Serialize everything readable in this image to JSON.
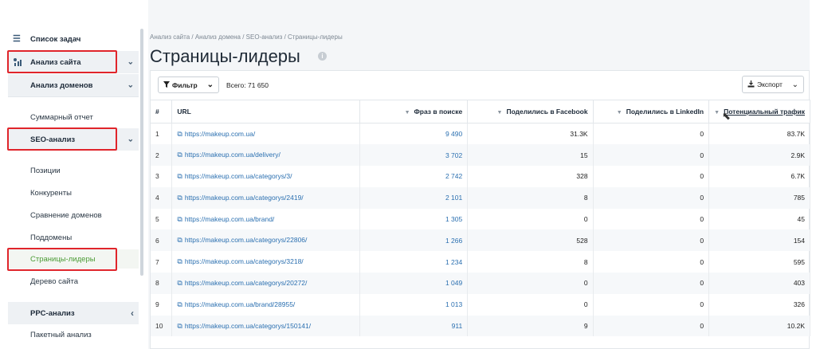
{
  "sidebar": {
    "tasks": "Список задач",
    "site_analysis": "Анализ сайта",
    "domain_analysis": "Анализ доменов",
    "summary": "Суммарный отчет",
    "seo": "SEO-анализ",
    "positions": "Позиции",
    "competitors": "Конкуренты",
    "compare": "Сравнение доменов",
    "subdomains": "Поддомены",
    "leaders": "Страницы-лидеры",
    "tree": "Дерево сайта",
    "ppc": "PPC-анализ",
    "batch": "Пакетный анализ"
  },
  "main": {
    "breadcrumbs": "Анализ сайта / Анализ домена / SEO-анализ / Страницы-лидеры",
    "title": "Страницы-лидеры",
    "filter": "Фильтр",
    "total": "Всего: 71 650",
    "export": "Экспорт"
  },
  "table": {
    "headers": [
      "#",
      "URL",
      "Фраз в поиске",
      "Поделились в Facebook",
      "Поделились в LinkedIn",
      "Потенциальный трафик"
    ],
    "rows": [
      [
        "1",
        "https://makeup.com.ua/",
        "9 490",
        "31.3K",
        "0",
        "83.7K"
      ],
      [
        "2",
        "https://makeup.com.ua/delivery/",
        "3 702",
        "15",
        "0",
        "2.9K"
      ],
      [
        "3",
        "https://makeup.com.ua/categorys/3/",
        "2 742",
        "328",
        "0",
        "6.7K"
      ],
      [
        "4",
        "https://makeup.com.ua/categorys/2419/",
        "2 101",
        "8",
        "0",
        "785"
      ],
      [
        "5",
        "https://makeup.com.ua/brand/",
        "1 305",
        "0",
        "0",
        "45"
      ],
      [
        "6",
        "https://makeup.com.ua/categorys/22806/",
        "1 266",
        "528",
        "0",
        "154"
      ],
      [
        "7",
        "https://makeup.com.ua/categorys/3218/",
        "1 234",
        "8",
        "0",
        "595"
      ],
      [
        "8",
        "https://makeup.com.ua/categorys/20272/",
        "1 049",
        "0",
        "0",
        "403"
      ],
      [
        "9",
        "https://makeup.com.ua/brand/28955/",
        "1 013",
        "0",
        "0",
        "326"
      ],
      [
        "10",
        "https://makeup.com.ua/categorys/150141/",
        "911",
        "9",
        "0",
        "10.2K"
      ]
    ]
  },
  "colors": {
    "highlight": "#e0252b",
    "link": "#2a6fb0",
    "active": "#4a9b34"
  }
}
